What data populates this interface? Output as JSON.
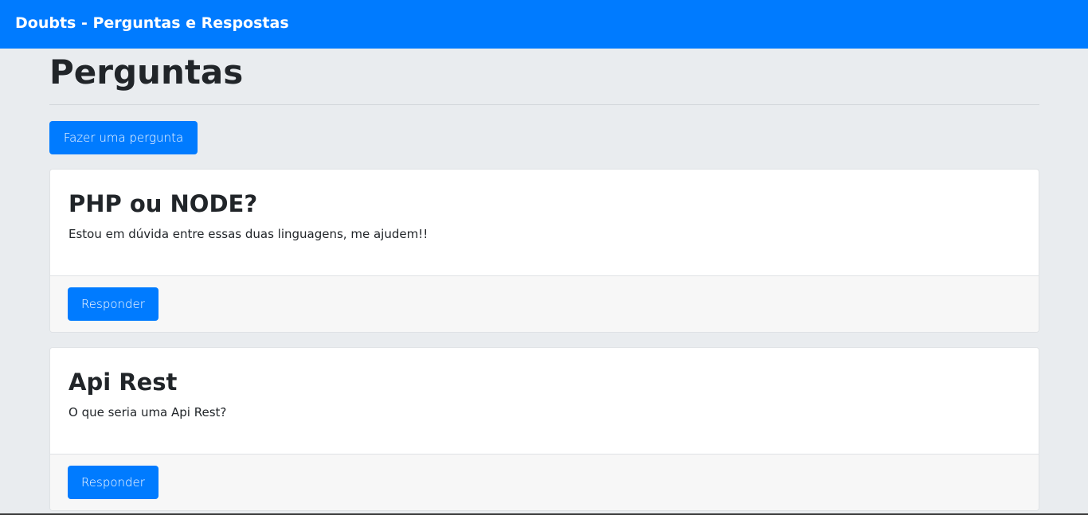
{
  "navbar": {
    "brand": "Doubts - Perguntas e Respostas"
  },
  "page": {
    "title": "Perguntas",
    "ask_button_label": "Fazer uma pergunta"
  },
  "questions": [
    {
      "title": "PHP ou NODE?",
      "description": "Estou em dúvida entre essas duas linguagens, me ajudem!!",
      "reply_label": "Responder"
    },
    {
      "title": "Api Rest",
      "description": "O que seria uma Api Rest?",
      "reply_label": "Responder"
    }
  ],
  "colors": {
    "primary": "#007bff",
    "background": "#e9ecef",
    "card": "#ffffff",
    "card_footer": "#f7f7f7"
  }
}
